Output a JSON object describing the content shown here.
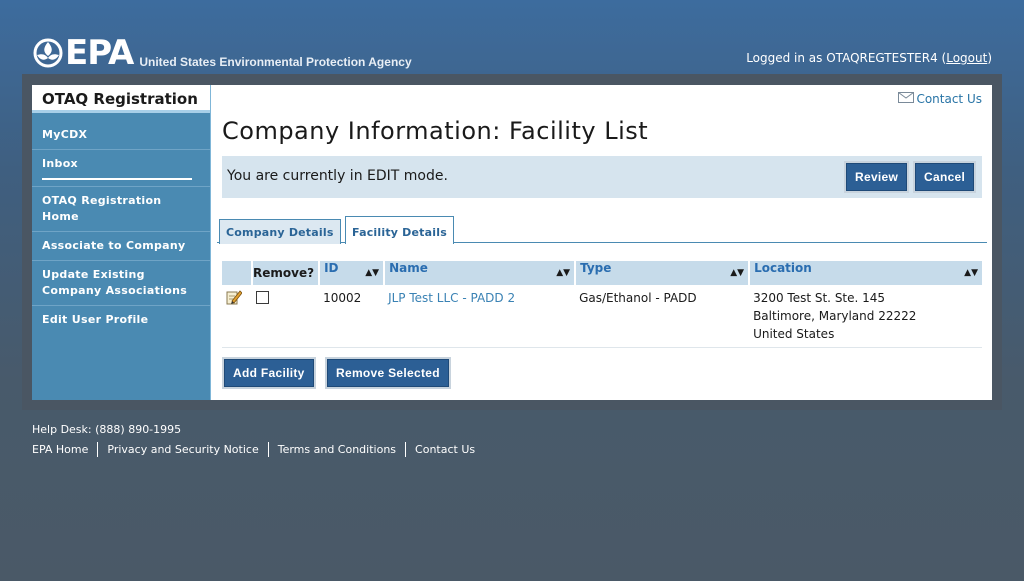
{
  "header": {
    "agency_letters": "EPA",
    "agency_name": "United States Environmental Protection Agency",
    "login_prefix": "Logged in as OTAQREGTESTER4 (",
    "logout_label": "Logout",
    "login_suffix": ")"
  },
  "sidebar": {
    "title": "OTAQ Registration",
    "items": [
      {
        "label": "MyCDX"
      },
      {
        "label": "Inbox"
      },
      {
        "label": "OTAQ Registration Home"
      },
      {
        "label": "Associate to Company"
      },
      {
        "label": "Update Existing Company Associations"
      },
      {
        "label": "Edit User Profile"
      }
    ]
  },
  "main": {
    "contact_us": "Contact Us",
    "page_title": "Company Information: Facility List",
    "edit_mode_text": "You are currently in EDIT mode.",
    "review_label": "Review",
    "cancel_label": "Cancel",
    "tabs": [
      {
        "label": "Company Details",
        "active": false
      },
      {
        "label": "Facility Details",
        "active": true
      }
    ],
    "table": {
      "headers": {
        "remove": "Remove?",
        "id": "ID",
        "name": "Name",
        "type": "Type",
        "location": "Location"
      },
      "rows": [
        {
          "id": "10002",
          "name": "JLP Test LLC - PADD 2",
          "type": "Gas/Ethanol - PADD",
          "location_line1": "3200 Test St. Ste. 145",
          "location_line2": "Baltimore, Maryland 22222",
          "location_line3": "United States",
          "remove_checked": false
        }
      ]
    },
    "add_facility_label": "Add Facility",
    "remove_selected_label": "Remove Selected"
  },
  "footer": {
    "helpdesk": "Help Desk: (888) 890-1995",
    "links": [
      "EPA Home",
      "Privacy and Security Notice",
      "Terms and Conditions",
      "Contact Us"
    ]
  },
  "colors": {
    "page_bg_top": "#3d6c9e",
    "page_bg_bottom": "#4a5967",
    "sidebar_bg": "#4a8ab2",
    "button_bg": "#2c5f95",
    "link": "#3a82b4",
    "table_header_bg": "#c6dbea",
    "edit_bar_bg": "#d6e4ee"
  }
}
